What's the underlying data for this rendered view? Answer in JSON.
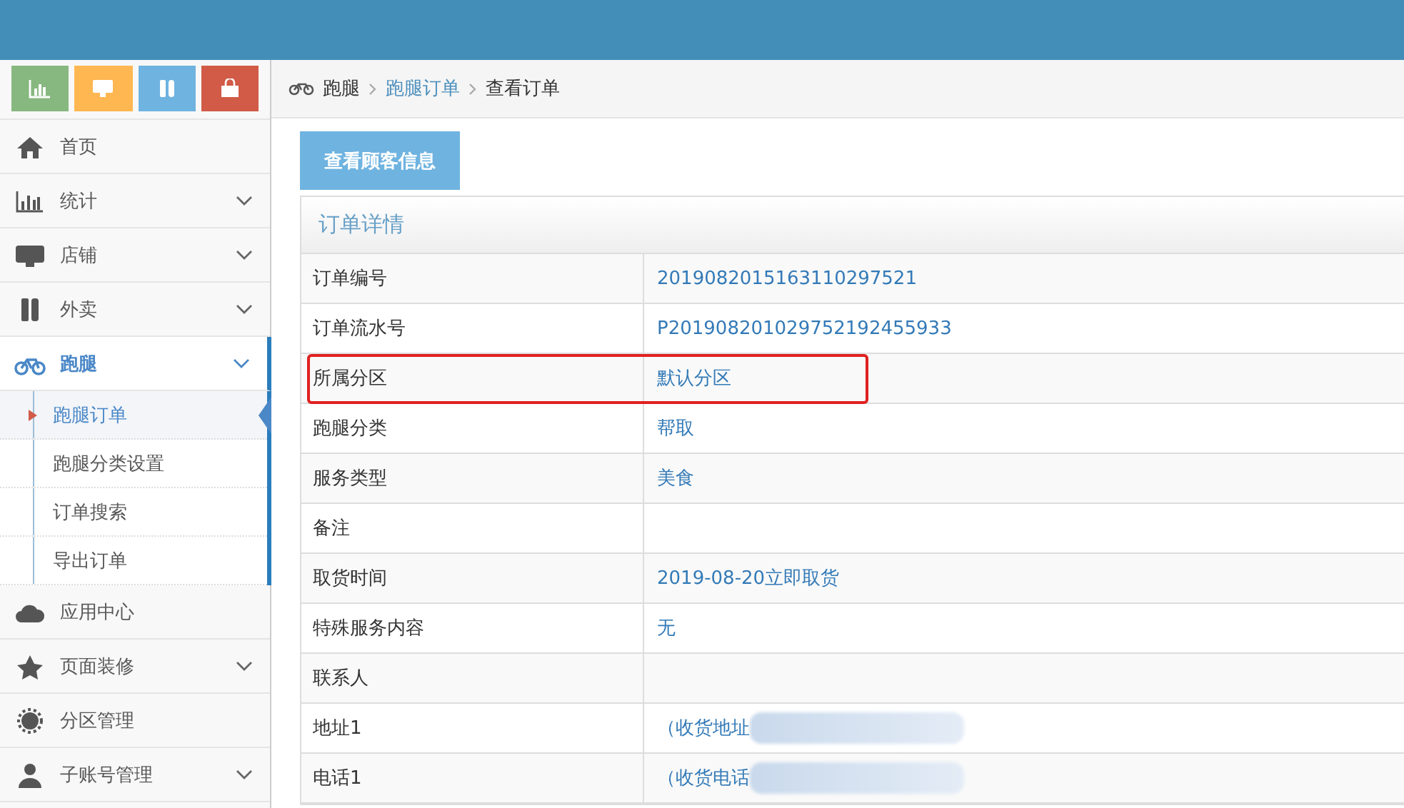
{
  "sidebar": {
    "shortcuts": [
      {
        "color": "#87b87f"
      },
      {
        "color": "#ffb752"
      },
      {
        "color": "#6fb3e0"
      },
      {
        "color": "#d15b47"
      }
    ],
    "items": [
      {
        "label": "首页",
        "expandable": false,
        "selected": false
      },
      {
        "label": "统计",
        "expandable": true,
        "selected": false
      },
      {
        "label": "店铺",
        "expandable": true,
        "selected": false
      },
      {
        "label": "外卖",
        "expandable": true,
        "selected": false
      },
      {
        "label": "跑腿",
        "expandable": true,
        "selected": true,
        "expanded": true,
        "children": [
          {
            "label": "跑腿订单",
            "selected": true
          },
          {
            "label": "跑腿分类设置",
            "selected": false
          },
          {
            "label": "订单搜索",
            "selected": false
          },
          {
            "label": "导出订单",
            "selected": false
          }
        ]
      },
      {
        "label": "应用中心",
        "expandable": false,
        "selected": false
      },
      {
        "label": "页面装修",
        "expandable": true,
        "selected": false
      },
      {
        "label": "分区管理",
        "expandable": false,
        "selected": false
      },
      {
        "label": "子账号管理",
        "expandable": true,
        "selected": false
      }
    ]
  },
  "breadcrumb": [
    {
      "label": "跑腿",
      "link": false
    },
    {
      "label": "跑腿订单",
      "link": true
    },
    {
      "label": "查看订单",
      "link": false
    }
  ],
  "customer_button": "查看顾客信息",
  "details": {
    "title": "订单详情",
    "rows": [
      {
        "label": "订单编号",
        "value": "2019082015163110297521",
        "highlighted": false
      },
      {
        "label": "订单流水号",
        "value": "P201908201029752192455933",
        "highlighted": false
      },
      {
        "label": "所属分区",
        "value": "默认分区",
        "highlighted": true
      },
      {
        "label": "跑腿分类",
        "value": "帮取",
        "highlighted": false
      },
      {
        "label": "服务类型",
        "value": "美食",
        "highlighted": false
      },
      {
        "label": "备注",
        "highlighted": false
      },
      {
        "label": "取货时间",
        "value": "2019-08-20立即取货",
        "highlighted": false
      },
      {
        "label": "特殊服务内容",
        "value": "无",
        "highlighted": false
      },
      {
        "label": "联系人",
        "highlighted": false
      },
      {
        "label": "地址1",
        "value": "（收货地址",
        "redacted": true,
        "highlighted": false
      },
      {
        "label": "电话1",
        "value": "（收货电话",
        "redacted": true,
        "highlighted": false
      }
    ]
  }
}
